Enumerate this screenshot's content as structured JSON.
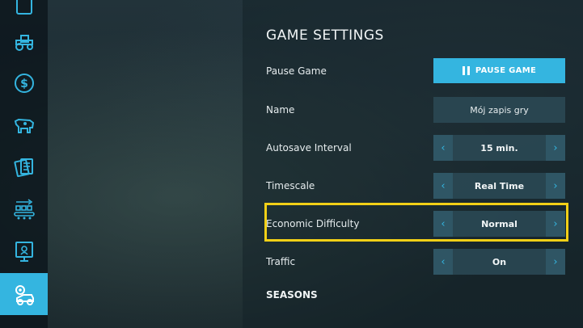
{
  "colors": {
    "accent": "#34b5e0",
    "highlight": "#f2d017",
    "sidebar_bg": "#0c161c"
  },
  "sidebar": {
    "items": [
      {
        "icon": "map-icon",
        "active": false
      },
      {
        "icon": "tractor-icon",
        "active": false
      },
      {
        "icon": "dollar-icon",
        "active": false
      },
      {
        "icon": "cow-icon",
        "active": false
      },
      {
        "icon": "contracts-icon",
        "active": false
      },
      {
        "icon": "production-icon",
        "active": false
      },
      {
        "icon": "help-icon",
        "active": false
      },
      {
        "icon": "settings-icon",
        "active": true
      }
    ]
  },
  "settings": {
    "heading": "GAME SETTINGS",
    "pause": {
      "label": "Pause Game",
      "button": "PAUSE GAME"
    },
    "name": {
      "label": "Name",
      "value": "Mój zapis gry"
    },
    "autosave": {
      "label": "Autosave Interval",
      "value": "15 min."
    },
    "timescale": {
      "label": "Timescale",
      "value": "Real Time"
    },
    "economic": {
      "label": "Economic Difficulty",
      "value": "Normal"
    },
    "traffic": {
      "label": "Traffic",
      "value": "On"
    },
    "section_seasons": "SEASONS"
  }
}
